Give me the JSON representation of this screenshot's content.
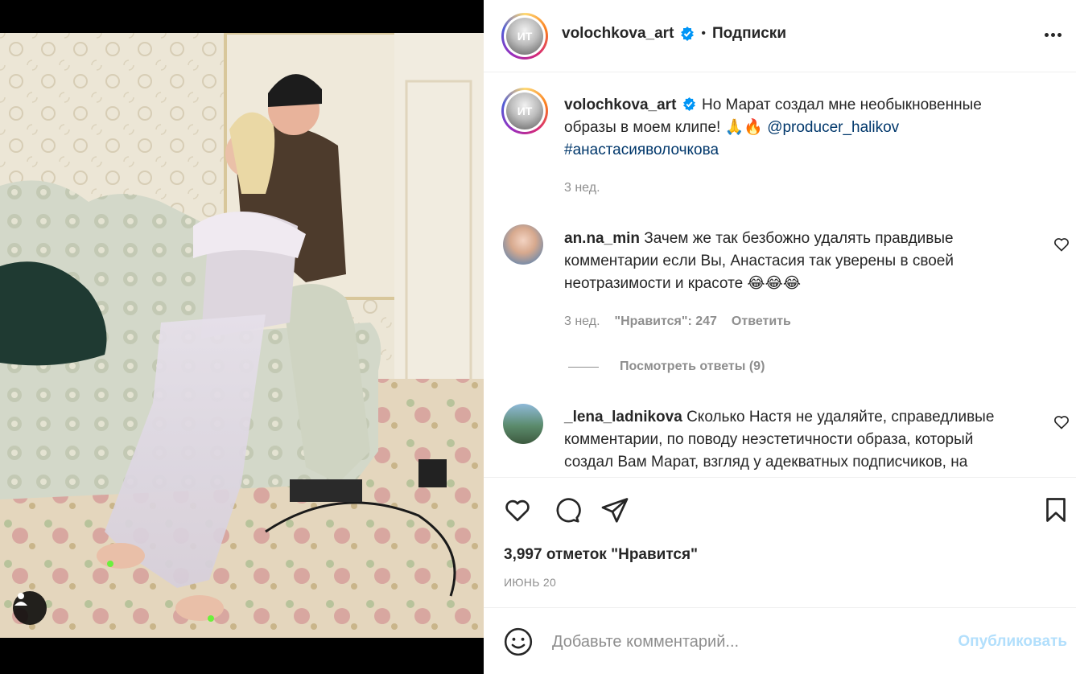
{
  "post": {
    "author": "volochkova_art",
    "follow_state": "Подписки",
    "separator": "•",
    "avatar_text": "ИТ"
  },
  "caption": {
    "author": "volochkova_art",
    "text": "Но Марат создал мне необыкновенные образы в моем клипе!",
    "emojis": "🙏🔥",
    "mention": "@producer_halikov",
    "hashtag": "#анастасияволочкова",
    "time": "3 нед."
  },
  "comments": [
    {
      "author": "an.na_min",
      "text": "Зачем же так безбожно удалять правдивые комментарии если Вы, Анастасия так уверены в своей неотразимости и красоте 😂😂😂",
      "time": "3 нед.",
      "likes": "\"Нравится\": 247",
      "reply_label": "Ответить",
      "view_replies": "Посмотреть ответы (9)"
    },
    {
      "author": "_lena_ladnikova",
      "text": "Сколько Настя не удаляйте, справедливые комментарии, по поводу неэстетичности образа, который создал Вам Марат, взгляд у адекватных подписчиков, на"
    }
  ],
  "footer": {
    "likes_count": "3,997 отметок \"Нравится\"",
    "date": "ИЮНЬ 20"
  },
  "compose": {
    "placeholder": "Добавьте комментарий...",
    "publish_label": "Опубликовать"
  },
  "icons": {
    "like": "heart-icon",
    "comment": "comment-icon",
    "share": "send-icon",
    "save": "bookmark-icon",
    "emoji": "smiley-icon",
    "more": "more-icon",
    "verified": "verified-badge-icon",
    "user_tag": "user-icon"
  },
  "colors": {
    "link": "#00376b",
    "muted": "#8e8e8e",
    "verified": "#0095f6",
    "publish_disabled": "#b2dffc"
  }
}
